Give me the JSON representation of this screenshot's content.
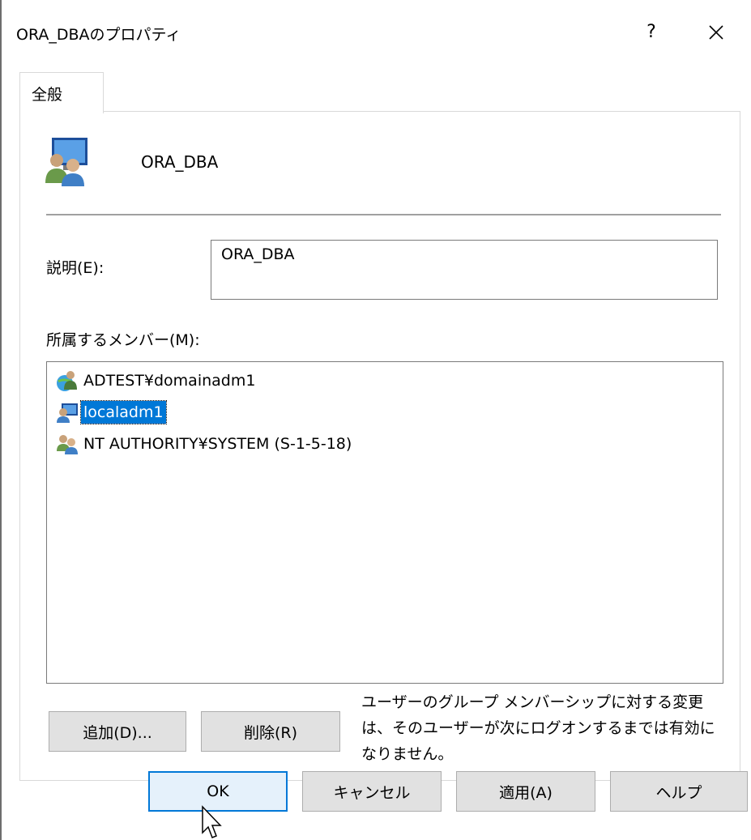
{
  "window": {
    "title": "ORA_DBAのプロパティ",
    "help_glyph": "?",
    "close_glyph": "close"
  },
  "tabs": [
    {
      "label": "全般",
      "active": true
    }
  ],
  "group": {
    "name": "ORA_DBA",
    "icon": "group-icon"
  },
  "description": {
    "label": "説明(E):",
    "value": "ORA_DBA"
  },
  "members": {
    "label": "所属するメンバー(M):",
    "items": [
      {
        "name": "ADTEST¥domainadm1",
        "icon": "domain-user-icon",
        "selected": false
      },
      {
        "name": "localadm1",
        "icon": "local-user-icon",
        "selected": true
      },
      {
        "name": "NT AUTHORITY¥SYSTEM (S-1-5-18)",
        "icon": "well-known-group-icon",
        "selected": false
      }
    ]
  },
  "actions": {
    "add_label": "追加(D)...",
    "remove_label": "削除(R)",
    "note": "ユーザーのグループ メンバーシップに対する変更は、そのユーザーが次にログオンするまでは有効になりません。"
  },
  "footer": {
    "ok_label": "OK",
    "cancel_label": "キャンセル",
    "apply_label": "適用(A)",
    "help_label": "ヘルプ"
  },
  "colors": {
    "selection": "#0078d7",
    "button_face": "#e1e1e1",
    "ok_face": "#e5f1fb"
  }
}
